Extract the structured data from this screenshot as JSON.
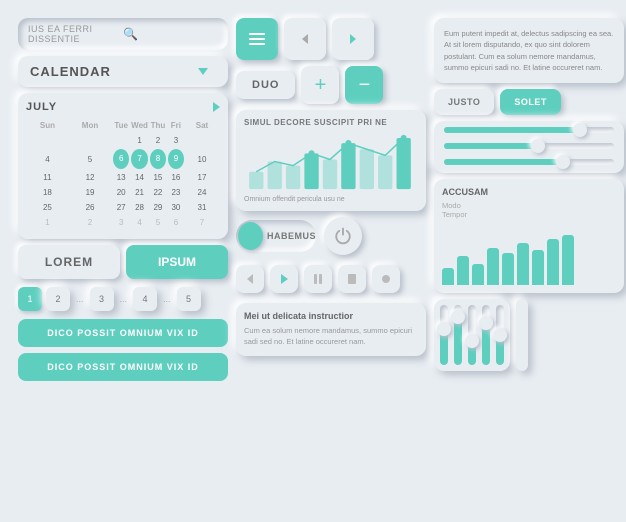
{
  "app": {
    "bg": "#e8edf2",
    "accent": "#5ecfbf"
  },
  "search": {
    "placeholder": "IUS EA FERRI DISSENTIE",
    "icon": "🔍"
  },
  "calendar": {
    "title": "CALENDAR",
    "month": "JULY",
    "days_header": [
      "Sun",
      "Mon",
      "Tue",
      "Wed",
      "Thu",
      "Fri",
      "Sat"
    ],
    "weeks": [
      [
        "",
        "",
        "",
        "1",
        "2",
        "3"
      ],
      [
        "4",
        "5",
        "6",
        "7",
        "8",
        "9",
        "10"
      ],
      [
        "11",
        "12",
        "13",
        "14",
        "15",
        "16",
        "17"
      ],
      [
        "18",
        "19",
        "20",
        "21",
        "22",
        "23",
        "24"
      ],
      [
        "25",
        "26",
        "27",
        "28",
        "29",
        "30",
        "31"
      ],
      [
        "1",
        "2",
        "3",
        "4",
        "5",
        "6",
        "7"
      ]
    ],
    "highlighted": [
      "6",
      "7",
      "8",
      "9"
    ],
    "prev_month_end": [
      "1",
      "2",
      "3"
    ],
    "next_month_start": [
      "1",
      "2",
      "3",
      "4",
      "5",
      "6",
      "7"
    ]
  },
  "buttons": {
    "lorem": "LOREM",
    "ipsum": "IPSUM",
    "duo": "DUO",
    "habemus": "HABEMUS",
    "dico1": "DICO POSSIT OMNIUM VIX ID",
    "dico2": "DICO POSSIT OMNIUM VIX ID"
  },
  "pagination": {
    "items": [
      "1",
      "2",
      "3",
      "4",
      "5"
    ],
    "active": 0,
    "separator": "..."
  },
  "tabs": {
    "justo": "JUSTO",
    "solet": "SOLET"
  },
  "sliders": {
    "s1_pct": 80,
    "s2_pct": 55,
    "s3_pct": 70
  },
  "text_block": {
    "body": "Eum putent impedit at, delectus sadipscing ea sea. At sit lorem disputando, ex quo sint dolorem postulant. Cum ea solum nemore mandamus, summo epicuri sadi no. Et latine occureret nam."
  },
  "chart": {
    "title": "SIMUL DECORE SUSCIPIT PRI NE",
    "caption": "Omnium offendit pericula usu ne",
    "bars": [
      30,
      45,
      35,
      50,
      40,
      60,
      55,
      48,
      65
    ]
  },
  "accusam": {
    "title": "ACCUSAM",
    "subs": [
      "Modo",
      "Tempor"
    ],
    "bars": [
      20,
      35,
      25,
      45,
      38,
      50,
      42,
      55,
      60
    ]
  },
  "media_controls": [
    "◀",
    "▶",
    "⏸",
    "■",
    "●"
  ],
  "bottom_text": {
    "title": "Mei ut delicata instructior",
    "body": "Cum ea solum nemore mandamus, summo epicuri sadi sed no. Et latine occureret nam."
  },
  "vertical_sliders": {
    "fills": [
      60,
      80,
      40,
      70,
      50
    ]
  },
  "mini_bars": {
    "rows": [
      {
        "label": "",
        "pct": 75
      },
      {
        "label": "",
        "pct": 50
      },
      {
        "label": "",
        "pct": 60
      }
    ]
  }
}
